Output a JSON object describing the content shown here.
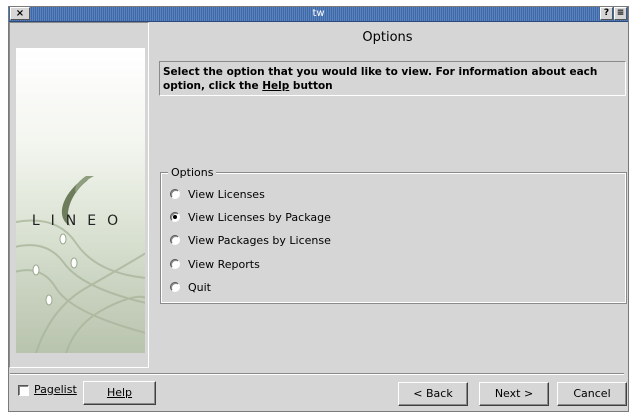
{
  "window": {
    "title": "tw",
    "close_glyph": "×",
    "help_glyph": "?",
    "menu_glyph": "≡"
  },
  "banner": {
    "logo_text": "LINEO"
  },
  "header": {
    "title": "Options"
  },
  "instruction": {
    "text_before": "Select the option that you would like to view. For information about each option, click the ",
    "help_word": "Help",
    "text_after": " button"
  },
  "options_group": {
    "legend": "Options",
    "items": [
      {
        "label": "View Licenses",
        "selected": false
      },
      {
        "label": "View Licenses by Package",
        "selected": true
      },
      {
        "label": "View Packages by License",
        "selected": false
      },
      {
        "label": "View Reports",
        "selected": false
      },
      {
        "label": "Quit",
        "selected": false
      }
    ]
  },
  "footer": {
    "pagelist_label": "Pagelist",
    "pagelist_checked": false,
    "help_label": "Help",
    "back_label": "< Back",
    "next_label": "Next >",
    "cancel_label": "Cancel"
  }
}
